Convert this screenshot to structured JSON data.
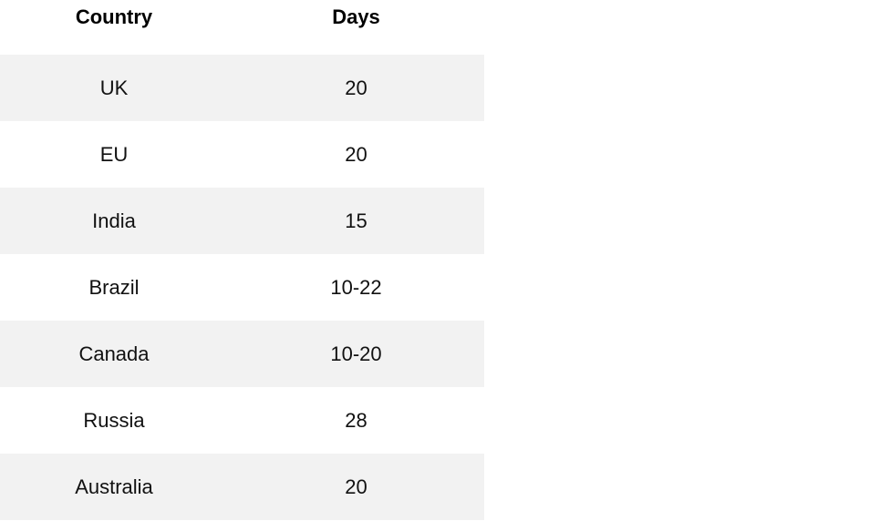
{
  "table": {
    "headers": [
      "Country",
      "Days"
    ],
    "rows": [
      {
        "country": "UK",
        "days": "20"
      },
      {
        "country": "EU",
        "days": "20"
      },
      {
        "country": "India",
        "days": "15"
      },
      {
        "country": "Brazil",
        "days": "10-22"
      },
      {
        "country": "Canada",
        "days": "10-20"
      },
      {
        "country": "Russia",
        "days": "28"
      },
      {
        "country": "Australia",
        "days": "20"
      }
    ]
  }
}
